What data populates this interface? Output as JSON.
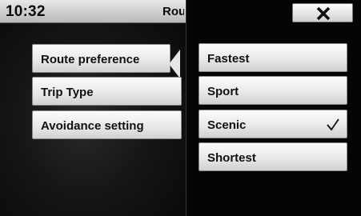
{
  "status_bar": {
    "time": "10:32",
    "title_partial": "Rou"
  },
  "menu": {
    "items": [
      {
        "label": "Route preference",
        "active": true
      },
      {
        "label": "Trip Type",
        "active": false
      },
      {
        "label": "Avoidance setting",
        "active": false
      }
    ]
  },
  "options_panel": {
    "close_icon": "close-x-icon",
    "options": [
      {
        "label": "Fastest",
        "selected": false
      },
      {
        "label": "Sport",
        "selected": false
      },
      {
        "label": "Scenic",
        "selected": true
      },
      {
        "label": "Shortest",
        "selected": false
      }
    ],
    "selected_icon": "checkmark-icon"
  },
  "colors": {
    "background": "#0a0a0a",
    "button_light": "#f0f0f0",
    "text": "#111111"
  }
}
